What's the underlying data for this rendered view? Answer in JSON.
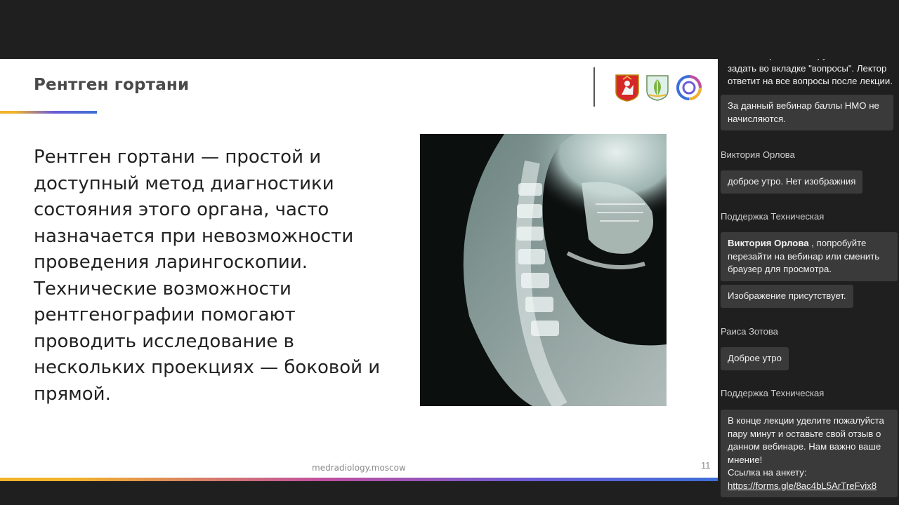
{
  "slide": {
    "title": "Рентген гортани",
    "body": "Рентген гортани — простой и доступный метод диагностики состояния этого органа, часто назначается при невозможности проведения ларингоскопии. Технические возможности рентгенографии помогают проводить исследование в нескольких проекциях — боковой и прямой.",
    "footer_url": "medradiology.moscow",
    "page_number": "11"
  },
  "chat": {
    "partial_message": "Ваши вопросы лектору вы можете задать во вкладке \"вопросы\".  Лектор ответит на все вопросы после лекции.",
    "messages": [
      {
        "text": "За данный вебинар баллы НМО не начисляются."
      },
      {
        "sender": "Виктория Орлова",
        "text": "доброе утро. Нет изображния"
      },
      {
        "sender": "Поддержка Техническая",
        "mention": "Виктория Орлова",
        "text": " , попробуйте перезайти на вебинар или сменить браузер для просмотра."
      },
      {
        "text": "Изображение присутствует."
      },
      {
        "sender": "Раиса Зотова",
        "text": "Доброе утро"
      },
      {
        "sender": "Поддержка Техническая",
        "text": "В конце лекции уделите пожалуйста пару минут и оставьте свой отзыв о данном вебинаре. Нам важно ваше мнение!",
        "link_label": "Ссылка на анкету:",
        "link": "https://forms.gle/8ac4bL5ArTreFvix8"
      }
    ]
  },
  "colors": {
    "chat_bubble": "#3a3a3a",
    "background": "#1f1f1f",
    "accent_gold": "#f2b32a",
    "accent_purple": "#6a5cd6"
  },
  "icons": [
    "moscow-coat-of-arms-icon",
    "medical-emblem-icon",
    "ring-logo-icon"
  ]
}
